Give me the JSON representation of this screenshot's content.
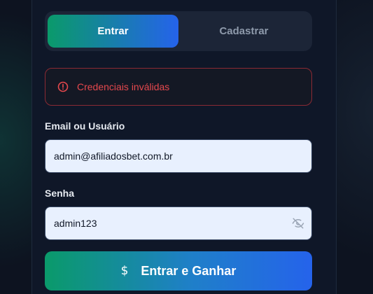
{
  "tabs": {
    "login_label": "Entrar",
    "register_label": "Cadastrar"
  },
  "alert": {
    "message": "Credenciais inválidas",
    "icon": "alert-circle-icon",
    "color": "#e5484d"
  },
  "form": {
    "email_label": "Email ou Usuário",
    "email_value": "admin@afiliadosbet.com.br",
    "password_label": "Senha",
    "password_value": "admin123",
    "password_toggle_icon": "eye-off-icon",
    "submit_icon": "dollar-icon",
    "submit_label": "Entrar e Ganhar"
  },
  "colors": {
    "gradient_start": "#0a9a6a",
    "gradient_end": "#2563eb",
    "background": "#0e1422"
  }
}
